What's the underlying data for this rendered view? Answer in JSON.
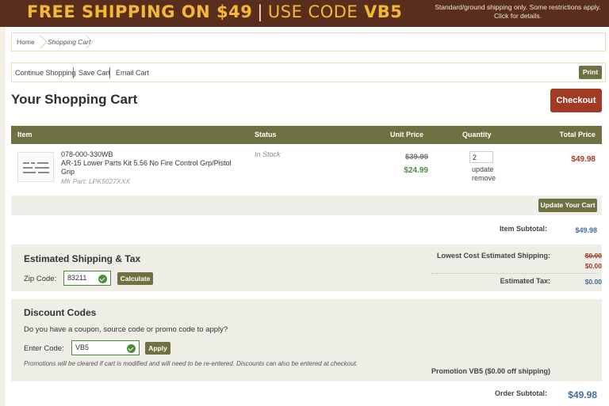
{
  "banner": {
    "part1": "FREE SHIPPING ON $49",
    "separator": "|",
    "part2": "USE CODE",
    "code": "VB5",
    "note_line1": "Standard/ground shipping only. Some restrictions apply.",
    "note_line2": "Click for details."
  },
  "breadcrumb": {
    "home": "Home",
    "current": "Shopping Cart"
  },
  "actions": {
    "continue": "Continue Shopping",
    "save": "Save Cart",
    "email": "Email Cart",
    "print": "Print"
  },
  "page_title": "Your Shopping Cart",
  "checkout_label": "Checkout",
  "table": {
    "headers": {
      "item": "Item",
      "status": "Status",
      "unit_price": "Unit Price",
      "quantity": "Quantity",
      "total_price": "Total Price"
    },
    "rows": [
      {
        "sku": "078-000-330WB",
        "name": "AR-15 Lower Parts Kit 5.56 No Fire Control Grp/Pistol Grip",
        "mfr": "Mfr Part: LPK5027XXX",
        "status": "In Stock",
        "old_price": "$39.99",
        "price": "$24.99",
        "quantity": "2",
        "update_link": "update",
        "remove_link": "remove",
        "total": "$49.98"
      }
    ]
  },
  "update_cart_label": "Update Your Cart",
  "summary": {
    "item_subtotal_label": "Item Subtotal:",
    "item_subtotal": "$49.98",
    "shipping_label": "Lowest Cost Estimated Shipping:",
    "shipping_old": "$0.00",
    "shipping_new": "$0.00",
    "tax_label": "Estimated Tax:",
    "tax": "$0.00",
    "promo_applied": "Promotion VB5 ($0.00 off shipping)",
    "order_subtotal_label": "Order Subtotal:",
    "order_subtotal": "$49.98"
  },
  "shipping_tax": {
    "title": "Estimated Shipping & Tax",
    "zip_label": "Zip Code:",
    "zip_value": "83211",
    "calculate_label": "Calculate"
  },
  "discount": {
    "title": "Discount Codes",
    "question": "Do you have a coupon, source code or promo code to apply?",
    "code_label": "Enter Code:",
    "code_value": "VB5",
    "apply_label": "Apply",
    "note": "Promotions will be cleared if cart is modified and will need to be re-entered. Discounts can also be entered at checkout."
  }
}
